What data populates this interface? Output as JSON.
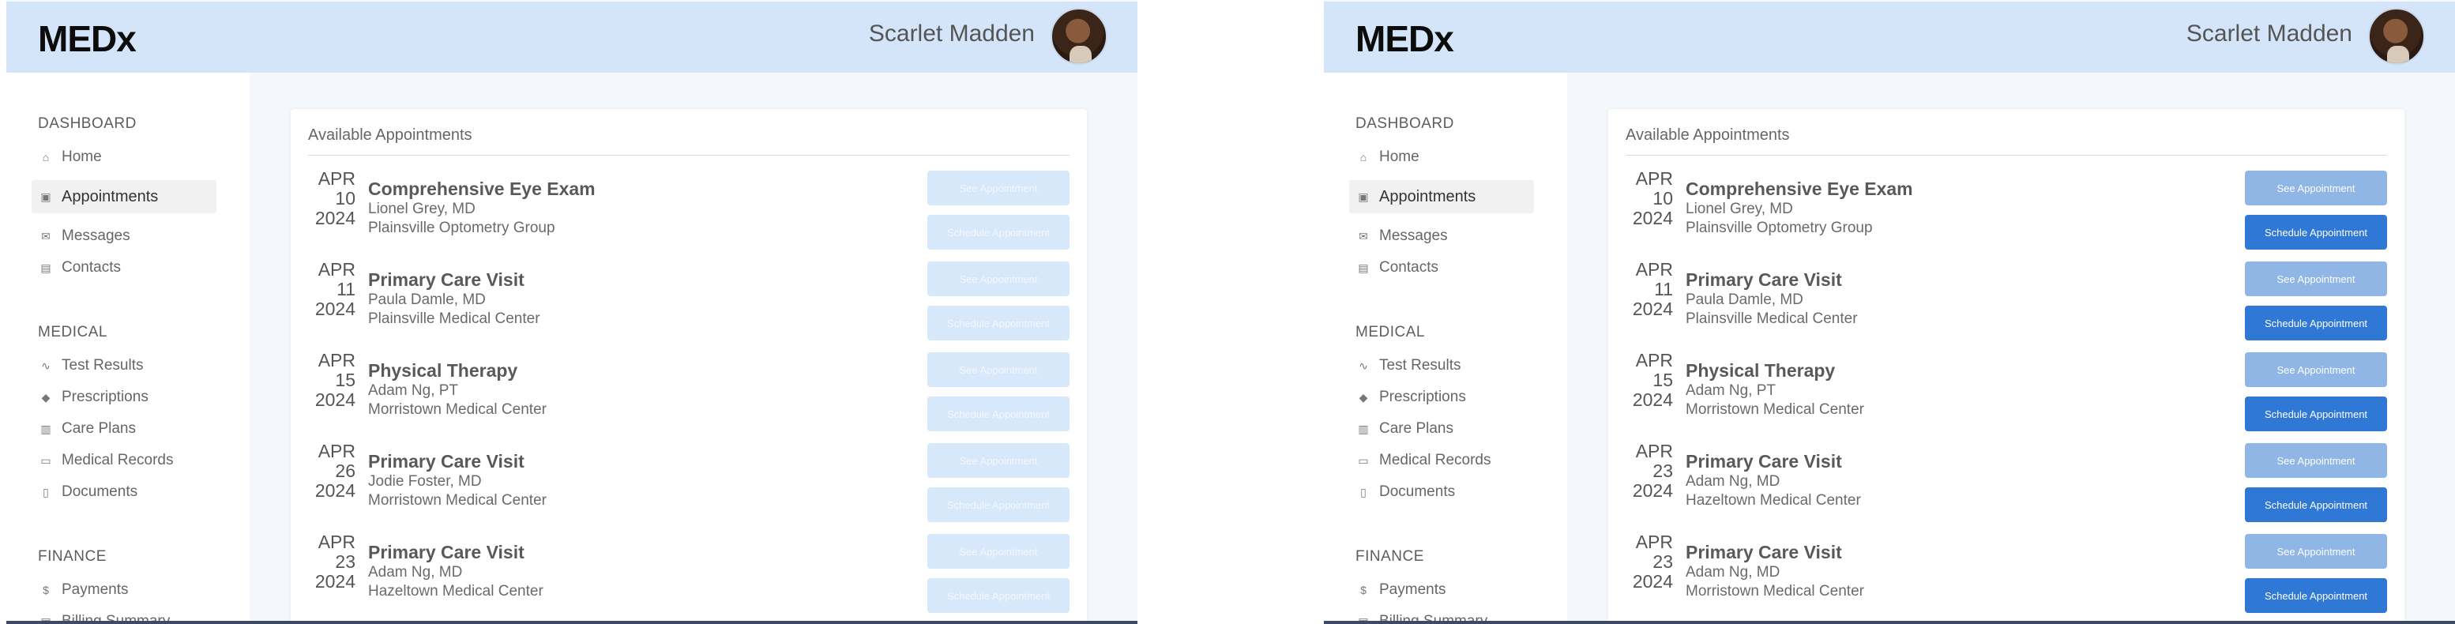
{
  "app": {
    "name": "MEDx"
  },
  "user": {
    "name": "Scarlet Madden"
  },
  "sidebar": {
    "sections": [
      {
        "label": "DASHBOARD",
        "items": [
          {
            "label": "Home",
            "icon": "home-icon"
          },
          {
            "label": "Appointments",
            "icon": "calendar-icon",
            "active": true
          },
          {
            "label": "Messages",
            "icon": "mail-icon"
          },
          {
            "label": "Contacts",
            "icon": "contacts-icon"
          }
        ]
      },
      {
        "label": "MEDICAL",
        "items": [
          {
            "label": "Test Results",
            "icon": "pulse-icon"
          },
          {
            "label": "Prescriptions",
            "icon": "pill-icon"
          },
          {
            "label": "Care Plans",
            "icon": "clipboard-icon"
          },
          {
            "label": "Medical Records",
            "icon": "folder-icon"
          },
          {
            "label": "Documents",
            "icon": "document-icon"
          }
        ]
      },
      {
        "label": "FINANCE",
        "items": [
          {
            "label": "Payments",
            "icon": "dollar-icon"
          },
          {
            "label": "Billing Summary",
            "icon": "receipt-icon"
          }
        ]
      }
    ]
  },
  "main": {
    "card_title": "Available Appointments",
    "see_label": "See Appointment",
    "schedule_label": "Schedule Appointment"
  },
  "left_panel": {
    "state": "disabled",
    "appointments": [
      {
        "month": "APR",
        "day": "10",
        "year": "2024",
        "title": "Comprehensive Eye Exam",
        "doctor": "Lionel Grey, MD",
        "location": "Plainsville Optometry Group"
      },
      {
        "month": "APR",
        "day": "11",
        "year": "2024",
        "title": "Primary Care Visit",
        "doctor": "Paula Damle, MD",
        "location": "Plainsville Medical Center"
      },
      {
        "month": "APR",
        "day": "15",
        "year": "2024",
        "title": "Physical Therapy",
        "doctor": "Adam Ng, PT",
        "location": "Morristown Medical Center"
      },
      {
        "month": "APR",
        "day": "26",
        "year": "2024",
        "title": "Primary Care Visit",
        "doctor": "Jodie Foster, MD",
        "location": "Morristown Medical Center"
      },
      {
        "month": "APR",
        "day": "23",
        "year": "2024",
        "title": "Primary Care Visit",
        "doctor": "Adam Ng, MD",
        "location": "Hazeltown Medical Center"
      }
    ]
  },
  "right_panel": {
    "state": "enabled",
    "appointments": [
      {
        "month": "APR",
        "day": "10",
        "year": "2024",
        "title": "Comprehensive Eye Exam",
        "doctor": "Lionel Grey, MD",
        "location": "Plainsville Optometry Group"
      },
      {
        "month": "APR",
        "day": "11",
        "year": "2024",
        "title": "Primary Care Visit",
        "doctor": "Paula Damle, MD",
        "location": "Plainsville Medical Center"
      },
      {
        "month": "APR",
        "day": "15",
        "year": "2024",
        "title": "Physical Therapy",
        "doctor": "Adam Ng, PT",
        "location": "Morristown Medical Center"
      },
      {
        "month": "APR",
        "day": "23",
        "year": "2024",
        "title": "Primary Care Visit",
        "doctor": "Adam Ng, MD",
        "location": "Hazeltown Medical Center"
      },
      {
        "month": "APR",
        "day": "23",
        "year": "2024",
        "title": "Primary Care Visit",
        "doctor": "Adam Ng, MD",
        "location": "Morristown Medical Center"
      }
    ]
  },
  "colors": {
    "header_bg": "#d4e5fa",
    "page_bg": "#f4f7fc",
    "disabled_button": "#d8e8fb",
    "see_button": "#8fb6e5",
    "schedule_button": "#2f78d6"
  }
}
